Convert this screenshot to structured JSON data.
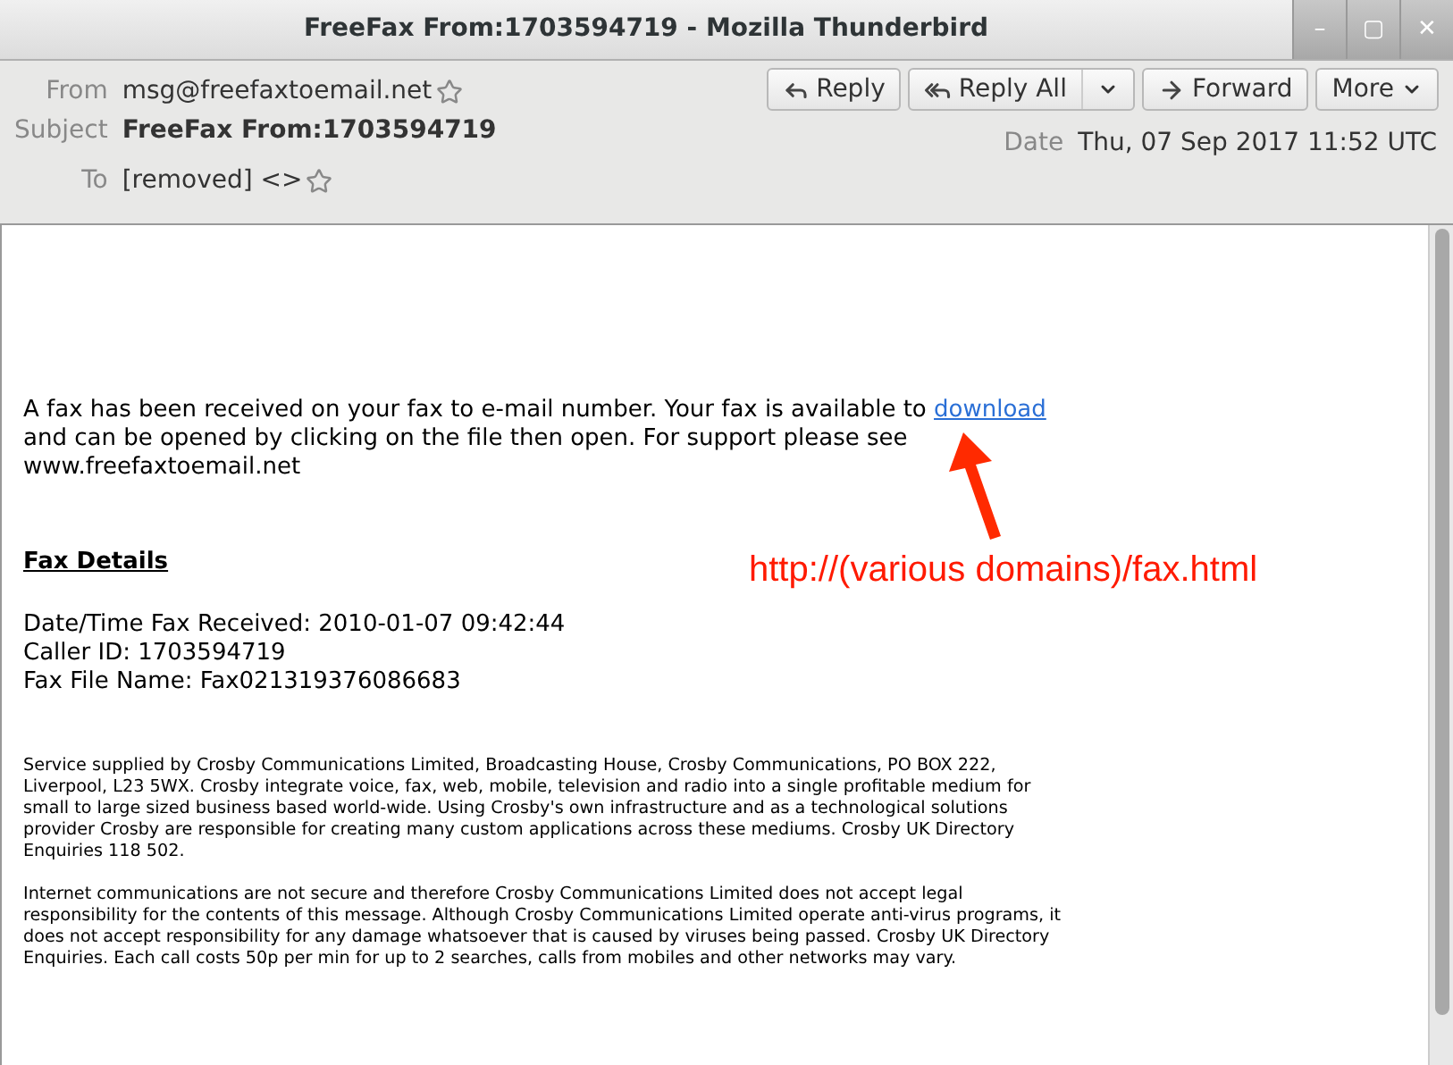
{
  "window": {
    "title": "FreeFax From:1703594719 - Mozilla Thunderbird",
    "controls": [
      "–",
      "▢",
      "✕"
    ]
  },
  "header": {
    "from_label": "From",
    "from": "msg@freefaxtoemail.net",
    "subject_label": "Subject",
    "subject": "FreeFax From:1703594719",
    "to_label": "To",
    "to": "[removed] <>",
    "date_label": "Date",
    "date": "Thu, 07 Sep 2017 11:52 UTC"
  },
  "actions": [
    {
      "label": "Reply",
      "kind": "reply"
    },
    {
      "label": "Reply All",
      "kind": "reply-all"
    },
    {
      "label": "Forward",
      "kind": "forward"
    },
    {
      "label": "More",
      "kind": "more"
    }
  ],
  "body": {
    "intro_before": "A fax has been received on your fax to e-mail number. Your fax is available to",
    "link": "download",
    "intro_after": "and can be opened by clicking on the file then open. For support please see www.freefaxtoemail.net",
    "details_heading": "Fax Details",
    "details": [
      "Date/Time Fax Received: 2010-01-07 09:42:44",
      "Caller ID: 1703594719",
      "Fax File Name: Fax021319376086683"
    ],
    "footer": [
      "Service supplied by Crosby Communications Limited, Broadcasting House, Crosby Communications, PO BOX 222, Liverpool, L23 5WX. Crosby integrate voice, fax, web, mobile, television and radio into a single profitable medium for small to large sized business based world-wide. Using Crosby's own infrastructure and as a technological solutions provider Crosby are responsible for creating many custom applications across these mediums. Crosby UK Directory Enquiries 118 502.",
      "Internet communications are not secure and therefore Crosby Communications Limited does not accept legal responsibility for the contents of this message. Although Crosby Communications Limited operate anti-virus programs, it does not accept responsibility for any damage whatsoever that is caused by viruses being passed. Crosby UK Directory Enquiries. Each call costs 50p per min for up to 2 searches, calls from mobiles and other networks may vary."
    ]
  },
  "annotation": {
    "text": "http://(various domains)/fax.html"
  }
}
